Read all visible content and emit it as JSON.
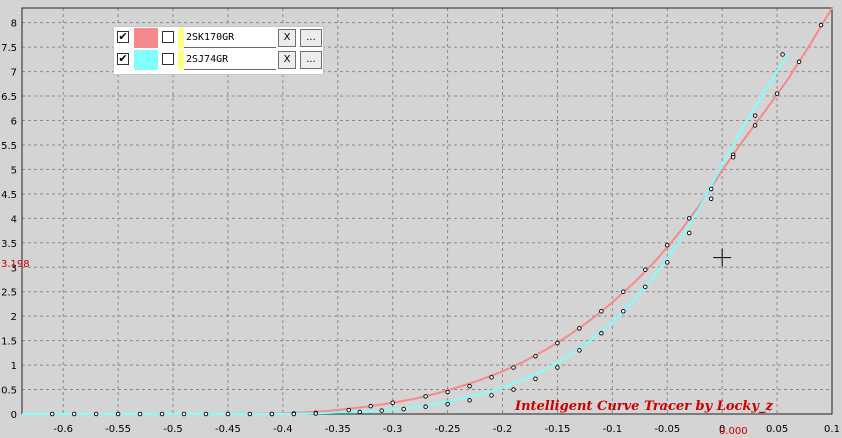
{
  "legend": {
    "items": [
      {
        "name": "2SK170GR",
        "checked_glyph": "✔",
        "color": "#f48a8a",
        "remove_label": "X",
        "more_label": "..."
      },
      {
        "name": "2SJ74GR",
        "checked_glyph": "✔",
        "color": "#80ffff",
        "remove_label": "X",
        "more_label": "..."
      }
    ]
  },
  "watermark": "Intelligent Curve Tracer by Locky_z",
  "cursor_readout": {
    "y_value": "3.198",
    "x_value": "0.000"
  },
  "colors": {
    "background": "#d4d4d4",
    "grid": "#8a8a8a",
    "axis": "#222222",
    "readout": "#cc0000",
    "curve_2SK170GR": "#f48a8a",
    "curve_2SJ74GR": "#80ffff"
  },
  "icons": {
    "crosshair": "crosshair-cursor-icon",
    "check": "check-icon"
  },
  "chart_data": {
    "type": "line",
    "x_ticks": [
      "-0.6",
      "-0.55",
      "-0.5",
      "-0.45",
      "-0.4",
      "-0.35",
      "-0.3",
      "-0.25",
      "-0.2",
      "-0.15",
      "-0.1",
      "-0.05",
      "0",
      "0.05",
      "0.1"
    ],
    "y_ticks": [
      "0",
      "0.5",
      "1",
      "1.5",
      "2",
      "2.5",
      "3",
      "3.5",
      "4",
      "4.5",
      "5",
      "5.5",
      "6",
      "6.5",
      "7",
      "7.5",
      "8"
    ],
    "xlim": [
      -0.6375,
      0.1
    ],
    "ylim": [
      0,
      8.3
    ],
    "grid": true,
    "legend_position": "top-left",
    "series": [
      {
        "name": "2SK170GR",
        "color": "#f48a8a",
        "x": [
          -0.6375,
          -0.45,
          -0.4,
          -0.36,
          -0.32,
          -0.3,
          -0.28,
          -0.26,
          -0.24,
          -0.22,
          -0.2,
          -0.18,
          -0.16,
          -0.14,
          -0.12,
          -0.1,
          -0.08,
          -0.06,
          -0.04,
          -0.02,
          0.0,
          0.02,
          0.04,
          0.06,
          0.08,
          0.1
        ],
        "y": [
          0,
          0,
          0.01,
          0.06,
          0.16,
          0.23,
          0.31,
          0.42,
          0.55,
          0.7,
          0.87,
          1.08,
          1.32,
          1.6,
          1.92,
          2.28,
          2.69,
          3.15,
          3.68,
          4.29,
          4.98,
          5.62,
          6.22,
          6.85,
          7.55,
          8.3
        ]
      },
      {
        "name": "2SJ74GR",
        "color": "#80ffff",
        "x": [
          -0.6375,
          -0.4,
          -0.36,
          -0.32,
          -0.3,
          -0.28,
          -0.26,
          -0.24,
          -0.22,
          -0.2,
          -0.18,
          -0.16,
          -0.14,
          -0.12,
          -0.1,
          -0.08,
          -0.06,
          -0.04,
          -0.02,
          0.0,
          0.02,
          0.04,
          0.06
        ],
        "y": [
          0,
          0,
          0.02,
          0.06,
          0.09,
          0.14,
          0.21,
          0.3,
          0.41,
          0.54,
          0.71,
          0.92,
          1.18,
          1.5,
          1.88,
          2.33,
          2.87,
          3.5,
          4.24,
          5.1,
          5.9,
          6.65,
          7.35
        ]
      }
    ],
    "markers": [
      {
        "series": 0,
        "x": [
          -0.41,
          -0.39,
          -0.37,
          -0.34,
          -0.32,
          -0.3,
          -0.27,
          -0.25,
          -0.23,
          -0.21,
          -0.19,
          -0.17,
          -0.15,
          -0.13,
          -0.11,
          -0.09,
          -0.07,
          -0.05,
          -0.03,
          -0.01,
          0.01,
          0.03,
          0.05,
          0.07,
          0.09
        ],
        "y": [
          0.0,
          0.01,
          0.02,
          0.08,
          0.16,
          0.23,
          0.36,
          0.45,
          0.57,
          0.75,
          0.95,
          1.18,
          1.45,
          1.75,
          2.1,
          2.5,
          2.95,
          3.45,
          4.0,
          4.6,
          5.3,
          5.9,
          6.55,
          7.2,
          7.95
        ]
      },
      {
        "series": 1,
        "x": [
          -0.61,
          -0.59,
          -0.57,
          -0.55,
          -0.53,
          -0.51,
          -0.49,
          -0.47,
          -0.45,
          -0.43,
          -0.41,
          -0.39,
          -0.37,
          -0.33,
          -0.31,
          -0.29,
          -0.27,
          -0.25,
          -0.23,
          -0.21,
          -0.19,
          -0.17,
          -0.15,
          -0.13,
          -0.11,
          -0.09,
          -0.07,
          -0.05,
          -0.03,
          -0.01,
          0.01,
          0.03,
          0.055
        ],
        "y": [
          0,
          0,
          0,
          0,
          0,
          0,
          0,
          0,
          0,
          0,
          0,
          0,
          0.01,
          0.04,
          0.07,
          0.1,
          0.15,
          0.2,
          0.28,
          0.38,
          0.5,
          0.72,
          0.95,
          1.3,
          1.65,
          2.1,
          2.6,
          3.1,
          3.7,
          4.4,
          5.25,
          6.1,
          7.35
        ]
      }
    ],
    "cursor": {
      "x": 0.0,
      "y": 3.198
    }
  }
}
